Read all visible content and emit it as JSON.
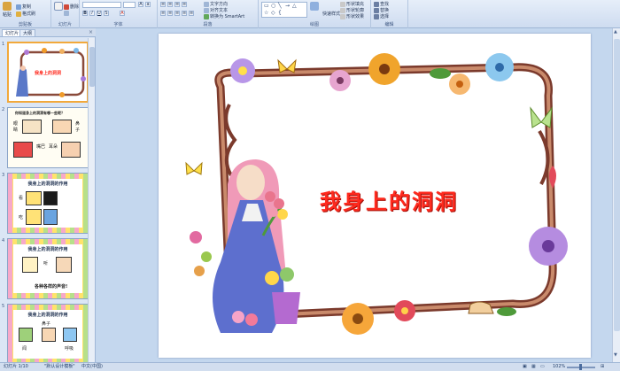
{
  "ribbon": {
    "clipboard": {
      "paste": "粘贴",
      "copy": "复制",
      "format_painter": "格式刷",
      "group": "剪贴板"
    },
    "slides": {
      "delete": "删除",
      "group": "幻灯片"
    },
    "font": {
      "group": "字体"
    },
    "paragraph": {
      "text_direction": "文字方向",
      "align_text": "对齐文本",
      "smartart": "转换为 SmartArt",
      "group": "段落"
    },
    "drawing": {
      "arrange": "排列",
      "quick_styles": "快速样式",
      "shape_fill": "形状填充",
      "shape_outline": "形状轮廓",
      "shape_effects": "形状效果",
      "group": "绘图"
    },
    "editing": {
      "find": "查找",
      "replace": "替换",
      "select": "选择",
      "group": "编辑"
    }
  },
  "left_panel": {
    "tabs": [
      "幻灯片",
      "大纲"
    ],
    "close": "×",
    "slides": [
      {
        "num": "1",
        "title": "我身上的洞洞"
      },
      {
        "num": "2",
        "question": "你知道身上的洞洞有哪一些呢？",
        "labels": [
          "眼睛",
          "鼻子",
          "嘴巴",
          "耳朵"
        ]
      },
      {
        "num": "3",
        "title": "我身上的洞洞的作用",
        "labels": [
          "看",
          "吃"
        ]
      },
      {
        "num": "4",
        "title": "我身上的洞洞的作用",
        "labels": [
          "听",
          "各种各样的声音!"
        ]
      },
      {
        "num": "5",
        "title": "我身上的洞洞的作用",
        "labels": [
          "鼻子",
          "闻",
          "呼吸"
        ]
      }
    ]
  },
  "slide": {
    "title": "我身上的洞洞"
  },
  "status": {
    "slide_count": "幻灯片 1/10",
    "theme": "\"默认设计模板\"",
    "language": "中文(中国)",
    "zoom": "102%"
  },
  "colors": {
    "title_red": "#ff2a1e",
    "selected_border": "#f2a93b",
    "ribbon_bg": "#dbe6f5"
  }
}
